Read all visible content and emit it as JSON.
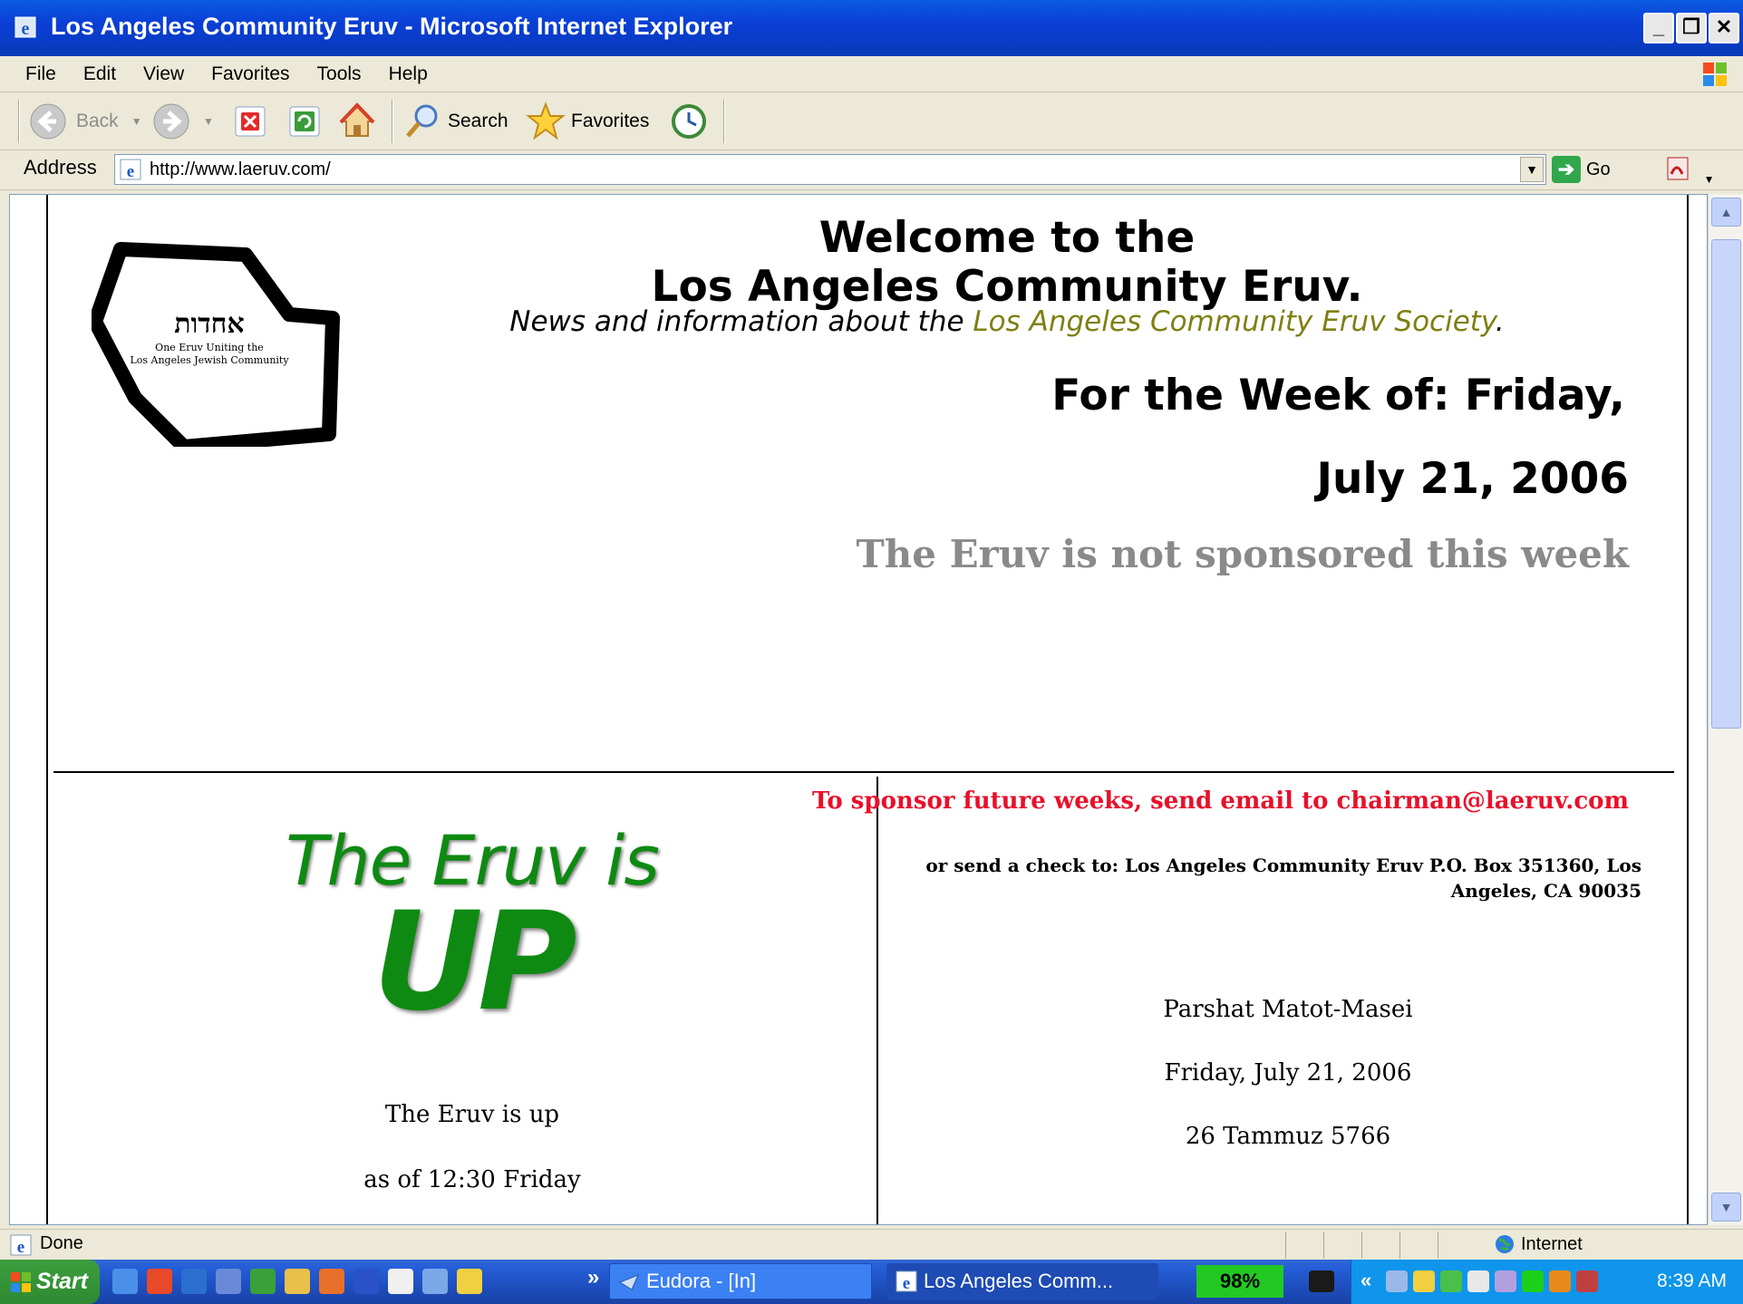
{
  "window": {
    "title": "Los Angeles Community Eruv - Microsoft Internet Explorer",
    "controls": [
      "_",
      "❐",
      "✕"
    ]
  },
  "menu": [
    "File",
    "Edit",
    "View",
    "Favorites",
    "Tools",
    "Help"
  ],
  "toolbar": {
    "back_label": "Back",
    "search_label": "Search",
    "favorites_label": "Favorites"
  },
  "address": {
    "label": "Address",
    "url": "http://www.laeruv.com/",
    "go_label": "Go"
  },
  "page": {
    "welcome_line1": "Welcome to the",
    "welcome_line2": "Los Angeles Community Eruv.",
    "subtitle_prefix": "News and information about the ",
    "subtitle_link": "Los Angeles Community Eruv Society",
    "subtitle_suffix": ".",
    "week_line1": "For the Week of: Friday,",
    "week_line2": "July 21, 2006",
    "sponsor_status": "The Eruv is not sponsored this week",
    "eruv_is": "The Eruv is",
    "eruv_state": "UP",
    "up_text1": "The Eruv is up",
    "up_text2": "as of 12:30 Friday",
    "sponsor_email": "To sponsor future weeks, send email to chairman@laeruv.com",
    "check_text": "or send a check to: Los Angeles Community Eruv P.O. Box 351360, Los Angeles, CA 90035",
    "parsha": "Parshat Matot-Masei",
    "parsha_date": "Friday, July 21, 2006",
    "hebrew_date": "26 Tammuz 5766",
    "logo_hebrew": "אחדות",
    "logo_line1": "One Eruv Uniting the",
    "logo_line2": "Los Angeles Jewish Community"
  },
  "status": {
    "text": "Done",
    "zone": "Internet"
  },
  "taskbar": {
    "start_label": "Start",
    "more": "»",
    "task1": "Eudora - [In]",
    "task2": "Los Angeles Comm...",
    "battery": "98%",
    "tray_more": "«",
    "clock": "8:39 AM"
  },
  "colors": {
    "title_blue": "#0a3fd6",
    "eruv_green": "#0e8a12",
    "sponsor_red": "#e8102a",
    "link_olive": "#7f7f13"
  }
}
